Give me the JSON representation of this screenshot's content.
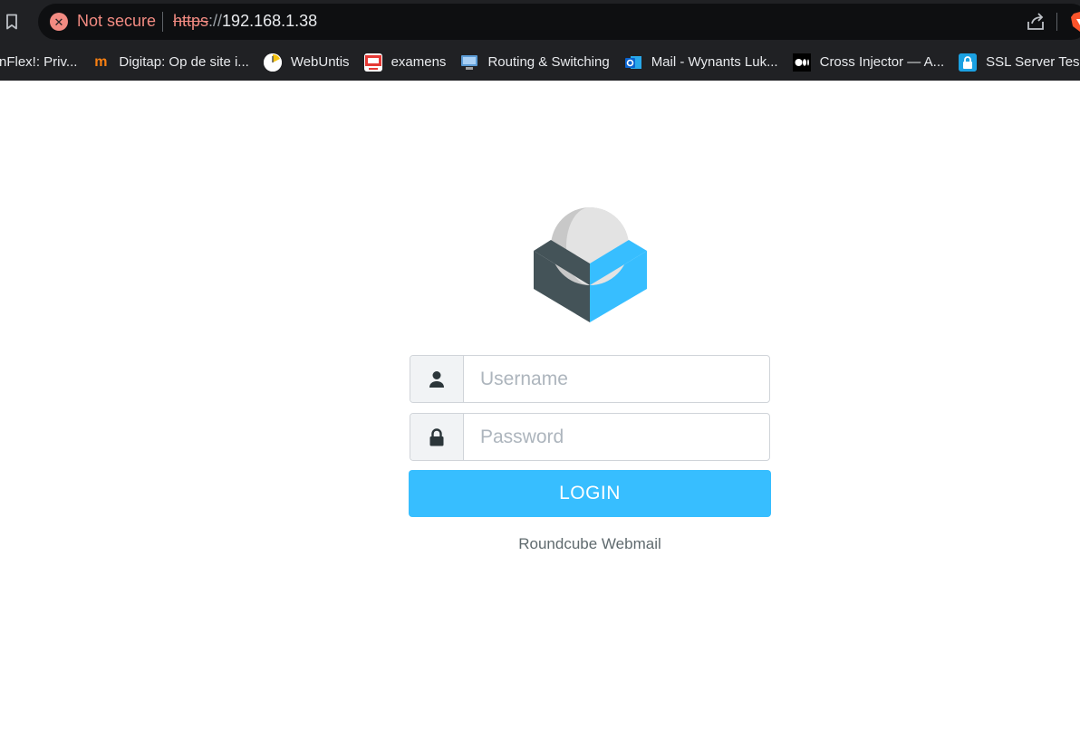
{
  "browser": {
    "security_label": "Not secure",
    "url_scheme": "https",
    "url_separator": "://",
    "url_host": "192.168.1.38",
    "bookmarks": [
      {
        "label": "nFlex!: Priv...",
        "icon": "flex-icon",
        "color": "#3a5a8c"
      },
      {
        "label": "Digitap: Op de site i...",
        "icon": "moodle-icon",
        "color": "#f98012"
      },
      {
        "label": "WebUntis",
        "icon": "webuntis-icon",
        "color": "#f4c20d"
      },
      {
        "label": "examens",
        "icon": "examens-icon",
        "color": "#e53935"
      },
      {
        "label": "Routing & Switching",
        "icon": "monitor-icon",
        "color": "#5b9bd5"
      },
      {
        "label": "Mail - Wynants Luk...",
        "icon": "outlook-icon",
        "color": "#0a64d0"
      },
      {
        "label": "Cross Injector — A...",
        "icon": "medium-icon",
        "color": "#000000"
      },
      {
        "label": "SSL Server Tes",
        "icon": "ssl-lock-icon",
        "color": "#1ba1e2"
      }
    ]
  },
  "login": {
    "username_placeholder": "Username",
    "password_placeholder": "Password",
    "button_label": "LOGIN",
    "product_name": "Roundcube Webmail",
    "accent_color": "#37beff"
  }
}
